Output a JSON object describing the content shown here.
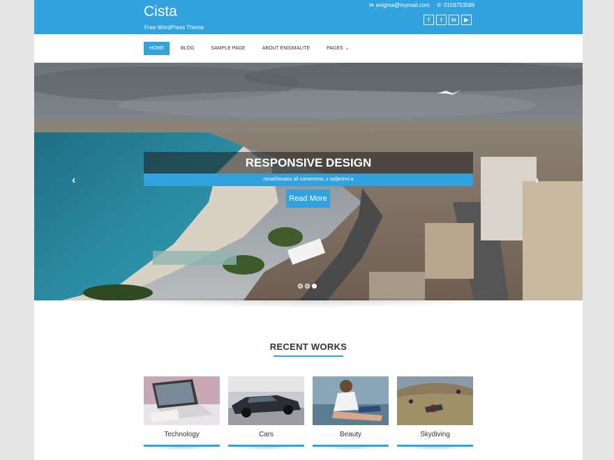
{
  "header": {
    "site_title": "Cista",
    "tagline": "Free WordPress Theme",
    "email": "enigma@mymail.com",
    "phone": "0159753586",
    "social": [
      {
        "icon": "facebook-icon",
        "glyph": "f"
      },
      {
        "icon": "twitter-icon",
        "glyph": "t"
      },
      {
        "icon": "linkedin-icon",
        "glyph": "in"
      },
      {
        "icon": "youtube-icon",
        "glyph": "▶"
      }
    ]
  },
  "nav": {
    "items": [
      "Home",
      "Blog",
      "Sample Page",
      "About Enigmalite",
      "Pages"
    ],
    "active_index": 0
  },
  "slider": {
    "title": "RESPONSIVE DESIGN",
    "subtitle": "nesačitovano ali namerema, z radjenimi a",
    "button": "Read More",
    "prev_glyph": "‹",
    "next_glyph": "›",
    "dot_count": 3,
    "active_dot": 2
  },
  "recent_works": {
    "heading": "RECENT WORKS",
    "items": [
      {
        "label": "Technology"
      },
      {
        "label": "Cars"
      },
      {
        "label": "Beauty"
      },
      {
        "label": "Skydiving"
      }
    ]
  },
  "colors": {
    "accent": "#31a2dd",
    "page_bg": "#e5e5e5"
  }
}
